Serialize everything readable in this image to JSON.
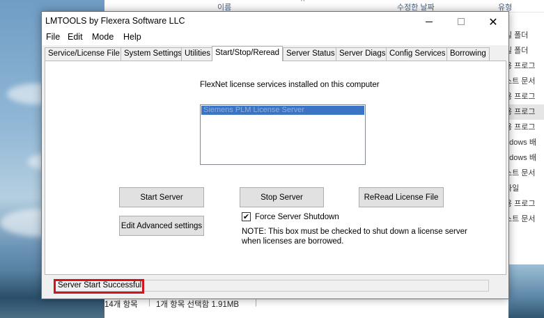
{
  "background": {
    "explorer_header": [
      "이름",
      "수정한 날짜",
      "유형"
    ],
    "type_column": [
      "일 폴더",
      "일 폴더",
      "용 프로그",
      "스트 문서",
      "용 프로그",
      "용 프로그",
      "용 프로그",
      "ndows 배",
      "ndows 배",
      "스트 문서",
      "파일",
      "용 프로그",
      "스트 문서"
    ],
    "status_items": "14개 항목",
    "status_selected": "1개 항목 선택함 1.91MB"
  },
  "window": {
    "title": "LMTOOLS by Flexera Software LLC",
    "controls": {
      "minimize": "—",
      "maximize": "☐",
      "close": "✕"
    }
  },
  "menu": [
    "File",
    "Edit",
    "Mode",
    "Help"
  ],
  "tabs": [
    "Service/License File",
    "System Settings",
    "Utilities",
    "Start/Stop/Reread",
    "Server Status",
    "Server Diags",
    "Config Services",
    "Borrowing"
  ],
  "active_tab": "Start/Stop/Reread",
  "panel": {
    "heading": "FlexNet license services installed on this computer",
    "services": [
      "Siemens PLM License Server"
    ],
    "buttons": {
      "start": "Start Server",
      "stop": "Stop Server",
      "reread": "ReRead License File",
      "advanced": "Edit Advanced settings"
    },
    "force_shutdown": {
      "label": "Force Server Shutdown",
      "checked": true
    },
    "note": "NOTE:  This box must be checked to shut down a license server when licenses are borrowed."
  },
  "status": "Server Start Successful.",
  "colors": {
    "selection": "#3b74c4",
    "highlight_box": "#d4121e"
  }
}
